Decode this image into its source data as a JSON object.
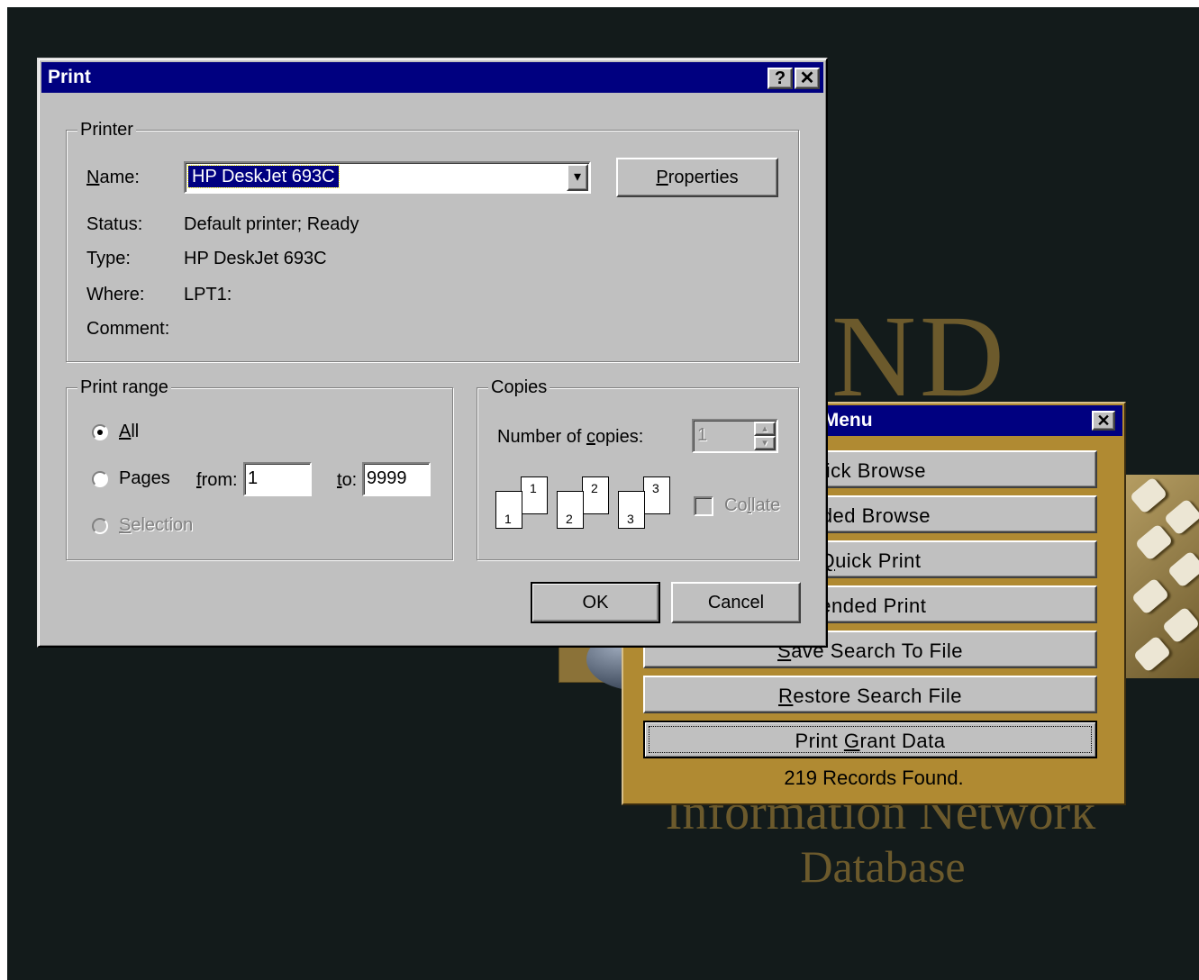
{
  "background": {
    "big_letters": "ND",
    "line1": "Information Network",
    "line2": "Database"
  },
  "browse_menu": {
    "title": "le Browse & Print Menu",
    "close_glyph": "✕",
    "buttons": [
      {
        "pre": "",
        "ul": "",
        "post": "uick Browse"
      },
      {
        "pre": "",
        "ul": "",
        "post": "nded Browse"
      },
      {
        "pre": "",
        "ul": "Q",
        "post": "uick Print"
      },
      {
        "pre": "",
        "ul": "",
        "post": "tended Print"
      },
      {
        "pre": "",
        "ul": "S",
        "post": "ave Search To File"
      },
      {
        "pre": "",
        "ul": "R",
        "post": "estore Search File"
      },
      {
        "pre": "Print ",
        "ul": "G",
        "post": "rant Data"
      }
    ],
    "status": "219 Records Found."
  },
  "print_dialog": {
    "title": "Print",
    "help_glyph": "?",
    "close_glyph": "✕",
    "printer_group": {
      "title": "Printer",
      "name_label_ul": "N",
      "name_label_rest": "ame:",
      "name_value": "HP DeskJet 693C",
      "dropdown_glyph": "▾",
      "properties_ul": "P",
      "properties_rest": "roperties",
      "status_label": "Status:",
      "status_value": "Default printer; Ready",
      "type_label": "Type:",
      "type_value": "HP DeskJet 693C",
      "where_label": "Where:",
      "where_value": "LPT1:",
      "comment_label": "Comment:",
      "comment_value": ""
    },
    "print_range": {
      "title": "Print range",
      "all_ul": "A",
      "all_rest": "ll",
      "pages_label": "Pages",
      "from_ul": "f",
      "from_rest": "rom:",
      "from_value": "1",
      "to_ul": "t",
      "to_rest": "o:",
      "to_value": "9999",
      "selection_ul": "S",
      "selection_rest": "election",
      "selected": "all"
    },
    "copies": {
      "title": "Copies",
      "number_label_pre": "Number of ",
      "number_label_ul": "c",
      "number_label_post": "opies:",
      "value": "1",
      "spin_up": "▴",
      "spin_down": "▾",
      "pages": [
        "1",
        "1",
        "2",
        "2",
        "3",
        "3"
      ],
      "collate_pre": "Co",
      "collate_ul": "l",
      "collate_post": "late",
      "collate_checked": false
    },
    "ok_label": "OK",
    "cancel_label": "Cancel"
  }
}
